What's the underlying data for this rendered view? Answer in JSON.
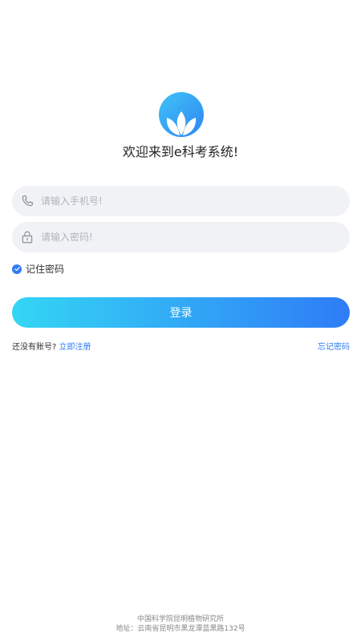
{
  "welcome_text": "欢迎来到e科考系统!",
  "phone_field": {
    "placeholder": "请输入手机号!",
    "value": ""
  },
  "password_field": {
    "placeholder": "请输入密码!",
    "value": ""
  },
  "remember": {
    "label": "记住密码",
    "checked": true
  },
  "login_button": {
    "label": "登录"
  },
  "register": {
    "prompt": "还没有账号?",
    "link_label": "立即注册"
  },
  "forgot_link": "忘记密码",
  "footer": {
    "org": "中国科学院昆明植物研究所",
    "address": "地址：云南省昆明市黑龙潭蓝黑路132号"
  },
  "icons": {
    "logo": "leaf-logo-icon",
    "phone": "phone-icon",
    "lock": "lock-icon",
    "check": "checkmark-icon"
  },
  "colors": {
    "accent": "#2f7cf6",
    "gradient_start": "#34d6f5",
    "gradient_end": "#2f7cf6",
    "input_bg": "#f0f2f5"
  }
}
